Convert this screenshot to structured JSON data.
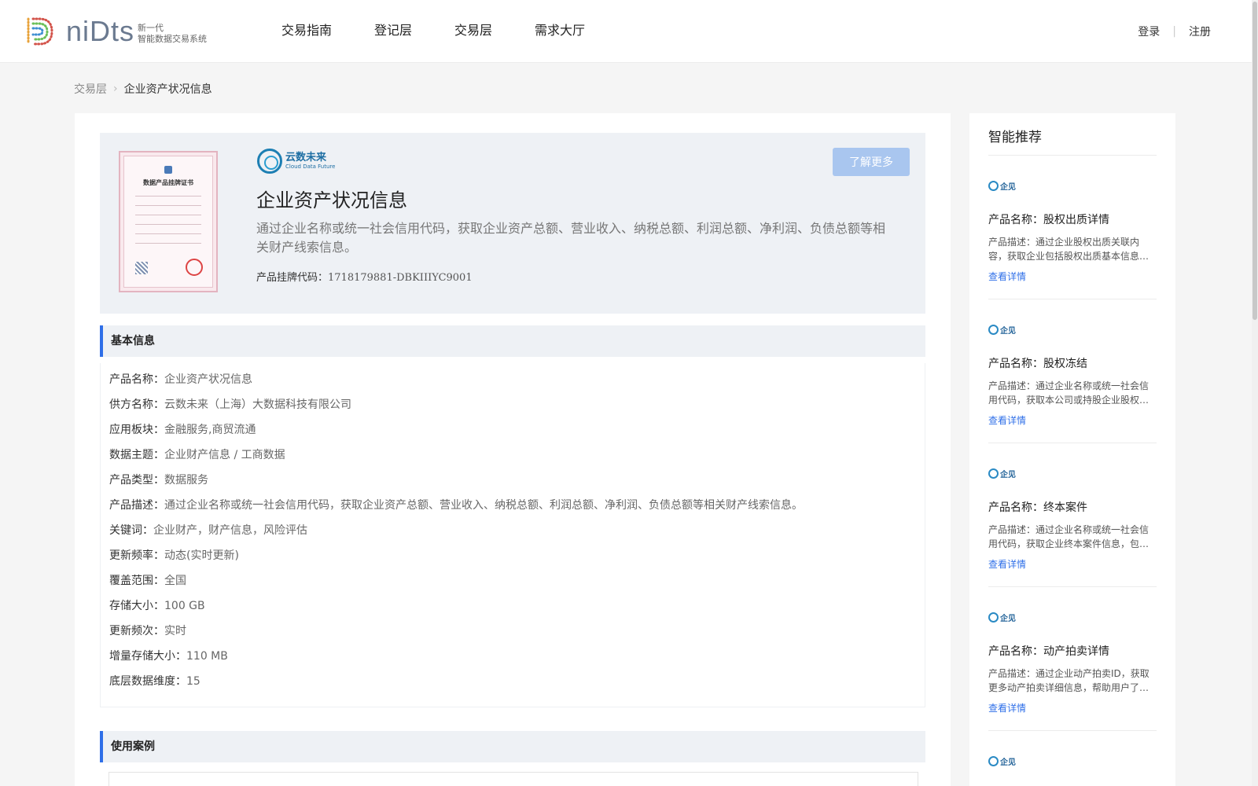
{
  "header": {
    "logo_word": "niDts",
    "logo_sub_line1": "新一代",
    "logo_sub_line2": "智能数据交易系统",
    "nav": [
      "交易指南",
      "登记层",
      "交易层",
      "需求大厅"
    ],
    "login": "登录",
    "register": "注册"
  },
  "breadcrumb": {
    "parent": "交易层",
    "current": "企业资产状况信息"
  },
  "summary": {
    "cert_title": "数据产品挂牌证书",
    "brand_cn": "云数未来",
    "brand_en": "Cloud Data Future",
    "learn_more": "了解更多",
    "title": "企业资产状况信息",
    "desc": "通过企业名称或统一社会信用代码，获取企业资产总额、营业收入、纳税总额、利润总额、净利润、负债总额等相关财产线索信息。",
    "code_label": "产品挂牌代码：",
    "code_value": "1718179881-DBKIIIYC9001"
  },
  "basic_info": {
    "heading": "基本信息",
    "rows": [
      {
        "label": "产品名称：",
        "value": "企业资产状况信息"
      },
      {
        "label": "供方名称：",
        "value": "云数未来（上海）大数据科技有限公司"
      },
      {
        "label": "应用板块：",
        "value": "金融服务,商贸流通"
      },
      {
        "label": "数据主题：",
        "value": "企业财产信息 / 工商数据"
      },
      {
        "label": "产品类型：",
        "value": "数据服务"
      },
      {
        "label": "产品描述：",
        "value": "通过企业名称或统一社会信用代码，获取企业资产总额、营业收入、纳税总额、利润总额、净利润、负债总额等相关财产线索信息。"
      },
      {
        "label": "关键词：",
        "value": "企业财产，财产信息，风险评估"
      },
      {
        "label": "更新频率：",
        "value": "动态(实时更新)"
      },
      {
        "label": "覆盖范围：",
        "value": "全国"
      },
      {
        "label": "存储大小：",
        "value": "100 GB"
      },
      {
        "label": "更新频次：",
        "value": "实时"
      },
      {
        "label": "增量存储大小：",
        "value": "110 MB"
      },
      {
        "label": "底层数据维度：",
        "value": "15"
      }
    ]
  },
  "use_cases": {
    "heading": "使用案例"
  },
  "sidebar": {
    "title": "智能推荐",
    "items": [
      {
        "logo": "企见",
        "name": "产品名称：股权出质详情",
        "desc": "产品描述：通过企业股权出质关联内容，获取企业包括股权出质基本信息等详细内容",
        "link": "查看详情"
      },
      {
        "logo": "企见",
        "name": "产品名称：股权冻结",
        "desc": "产品描述：通过企业名称或统一社会信用代码，获取本公司或持股企业股权冻结信息",
        "link": "查看详情"
      },
      {
        "logo": "企见",
        "name": "产品名称：终本案件",
        "desc": "产品描述：通过企业名称或统一社会信用代码，获取企业终本案件信息，包括案号等",
        "link": "查看详情"
      },
      {
        "logo": "企见",
        "name": "产品名称：动产拍卖详情",
        "desc": "产品描述：通过企业动产拍卖ID，获取更多动产拍卖详细信息，帮助用户了解详情",
        "link": "查看详情"
      },
      {
        "logo": "企见"
      }
    ]
  }
}
